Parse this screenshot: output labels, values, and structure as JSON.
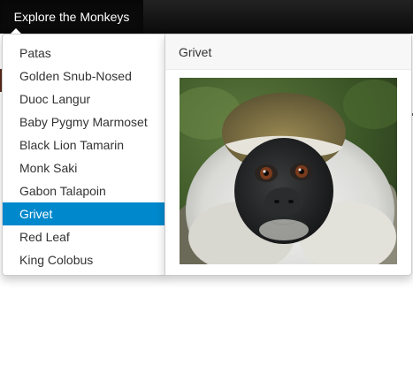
{
  "navbar": {
    "brand_label": "Explore the Monkeys"
  },
  "menu": {
    "items": [
      {
        "label": "Patas"
      },
      {
        "label": "Golden Snub-Nosed"
      },
      {
        "label": "Duoc Langur"
      },
      {
        "label": "Baby Pygmy Marmoset"
      },
      {
        "label": "Black Lion Tamarin"
      },
      {
        "label": "Monk Saki"
      },
      {
        "label": "Gabon Talapoin"
      },
      {
        "label": "Grivet"
      },
      {
        "label": "Red Leaf"
      },
      {
        "label": "King Colobus"
      }
    ],
    "active_item": "Grivet"
  },
  "detail": {
    "title": "Grivet",
    "image_subject": "grivet-monkey-photo"
  },
  "colors": {
    "navbar_bg": "#111111",
    "active_bg": "#0088cc",
    "active_text": "#ffffff",
    "menu_text": "#333333"
  }
}
